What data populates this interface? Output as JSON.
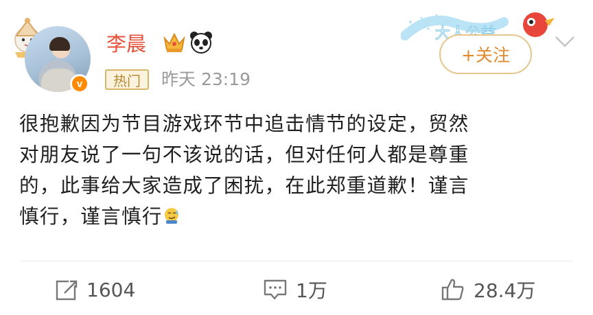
{
  "user": {
    "name": "李晨",
    "badge_letter": "v",
    "tag": "热门",
    "time": "昨天 23:19"
  },
  "follow_label": "+关注",
  "banner_text": "大人公益",
  "post": {
    "lines": [
      "很抱歉因为节目游戏环节中追击情节的设定，贸然",
      "对朋友说了一句不该说的话，但对任何人都是尊重",
      "的，此事给大家造成了困扰，在此郑重道歉！谨言",
      "慎行，谨言慎行"
    ]
  },
  "actions": {
    "repost_count": "1604",
    "comment_count": "1万",
    "like_count": "28.4万"
  },
  "colors": {
    "name": "#e5523a",
    "follow": "#e08a2c",
    "tag_border": "#d9b46b"
  }
}
